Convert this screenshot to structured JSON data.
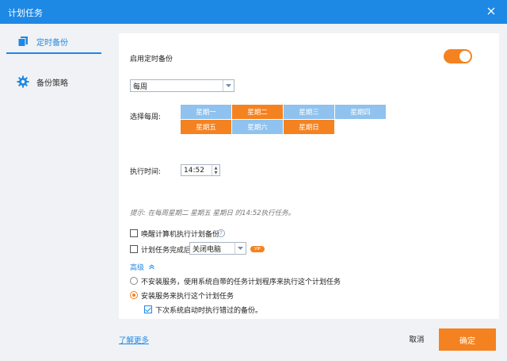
{
  "window": {
    "title": "计划任务"
  },
  "sidebar": {
    "items": [
      {
        "label": "定时备份",
        "icon": "copy-icon",
        "active": true
      },
      {
        "label": "备份策略",
        "icon": "gear-icon",
        "active": false
      }
    ]
  },
  "schedule": {
    "enable_label": "启用定时备份",
    "enabled": true,
    "frequency": "每周",
    "weekday_label": "选择每周:",
    "weekdays": [
      {
        "label": "星期一",
        "selected": false
      },
      {
        "label": "星期二",
        "selected": true
      },
      {
        "label": "星期三",
        "selected": false
      },
      {
        "label": "星期四",
        "selected": false
      },
      {
        "label": "星期五",
        "selected": true
      },
      {
        "label": "星期六",
        "selected": false
      },
      {
        "label": "星期日",
        "selected": true
      }
    ],
    "time_label": "执行时间:",
    "time": "14:52",
    "hint": "提示: 在每周星期二 星期五 星期日 的14:52执行任务。"
  },
  "options": {
    "wake_label": "唤醒计算机执行计划备份",
    "wake_checked": false,
    "after_label": "计划任务完成后",
    "after_checked": false,
    "after_action": "关闭电脑",
    "vip_badge": "VIP",
    "advanced_label": "高级",
    "radio_no_service": "不安装服务，使用系统自带的任务计划程序来执行这个计划任务",
    "radio_service": "安装服务来执行这个计划任务",
    "radio_selected": "service",
    "missed_label": "下次系统启动时执行错过的备份。",
    "missed_checked": true
  },
  "footer": {
    "learn_more": "了解更多",
    "cancel": "取消",
    "ok": "确定"
  },
  "colors": {
    "accent": "#1e88e5",
    "orange": "#f58220",
    "day_off": "#8fc2ee"
  }
}
